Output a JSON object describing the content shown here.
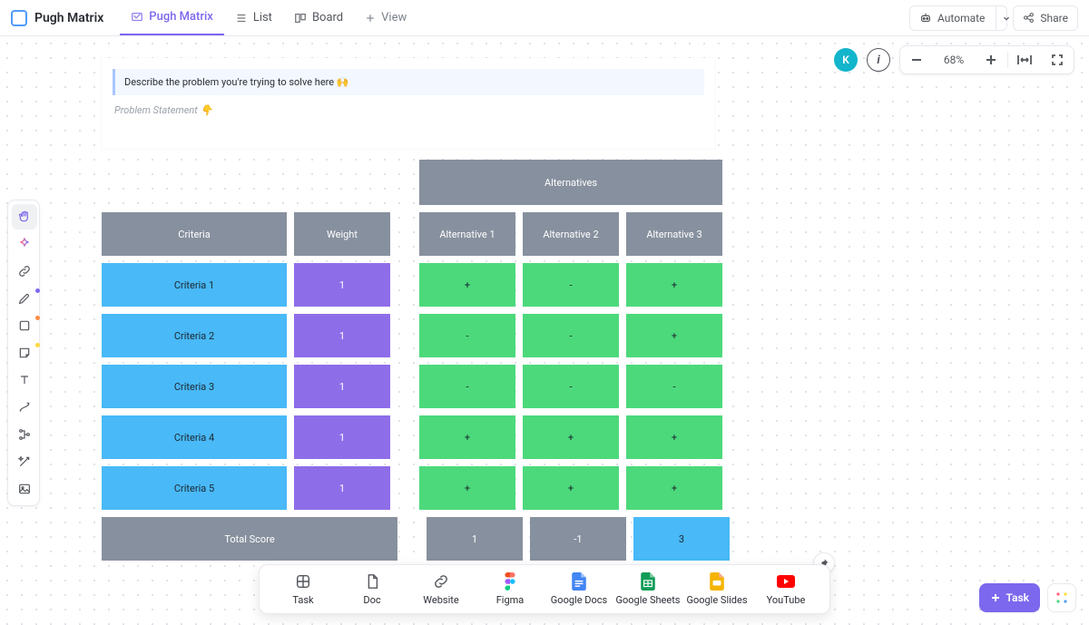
{
  "header": {
    "title": "Pugh Matrix",
    "tabs": [
      {
        "label": "Pugh Matrix",
        "icon": "whiteboard"
      },
      {
        "label": "List",
        "icon": "list"
      },
      {
        "label": "Board",
        "icon": "board"
      },
      {
        "label": "View",
        "icon": "plus"
      }
    ],
    "automate": "Automate",
    "share": "Share"
  },
  "toolbar_right": {
    "avatar_letter": "K",
    "zoom_value": "68%"
  },
  "document": {
    "problem_prompt": "Describe the problem you're trying to solve here 🙌",
    "problem_statement_label": "Problem Statement 👇"
  },
  "matrix": {
    "alt_header": "Alternatives",
    "criteria_header": "Criteria",
    "weight_header": "Weight",
    "alt_cols": [
      "Alternative 1",
      "Alternative 2",
      "Alternative 3"
    ],
    "rows": [
      {
        "criteria": "Criteria 1",
        "weight": "1",
        "vals": [
          "+",
          "-",
          "+"
        ]
      },
      {
        "criteria": "Criteria 2",
        "weight": "1",
        "vals": [
          "-",
          "-",
          "+"
        ]
      },
      {
        "criteria": "Criteria 3",
        "weight": "1",
        "vals": [
          "-",
          "-",
          "-"
        ]
      },
      {
        "criteria": "Criteria 4",
        "weight": "1",
        "vals": [
          "+",
          "+",
          "+"
        ]
      },
      {
        "criteria": "Criteria 5",
        "weight": "1",
        "vals": [
          "+",
          "+",
          "+"
        ]
      }
    ],
    "total_label": "Total Score",
    "totals": [
      "1",
      "-1",
      "3"
    ],
    "total_highlight_index": 2
  },
  "bottom_toolbar": [
    {
      "label": "Task",
      "color": "#54575d"
    },
    {
      "label": "Doc",
      "color": "#54575d"
    },
    {
      "label": "Website",
      "color": "#54575d"
    },
    {
      "label": "Figma",
      "color": "#f24e1e"
    },
    {
      "label": "Google Docs",
      "color": "#4285f4"
    },
    {
      "label": "Google Sheets",
      "color": "#0f9d58"
    },
    {
      "label": "Google Slides",
      "color": "#f4b400"
    },
    {
      "label": "YouTube",
      "color": "#ff0000"
    }
  ],
  "task_button": "Task"
}
